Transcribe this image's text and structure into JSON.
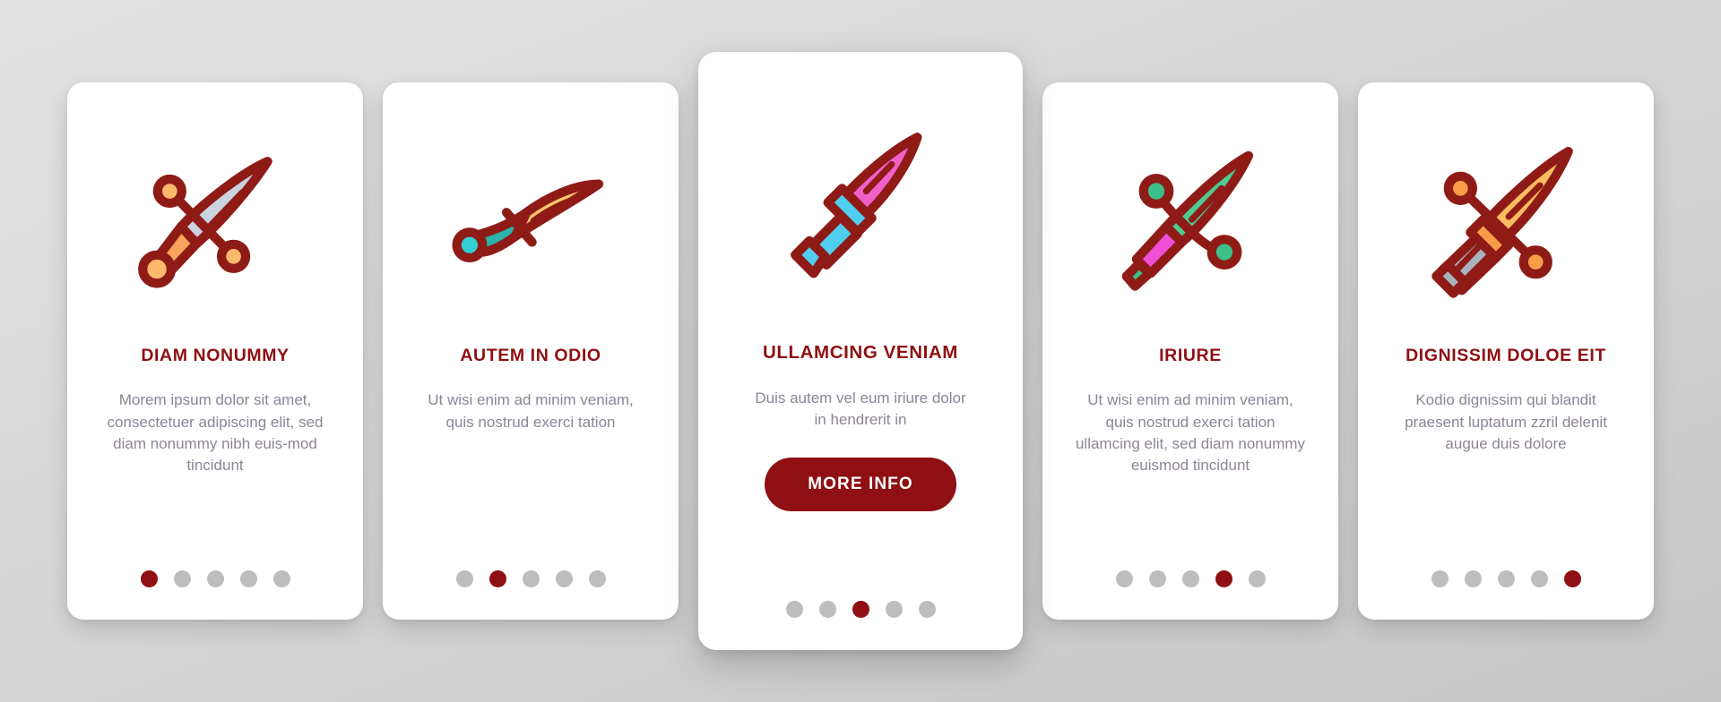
{
  "theme": {
    "accent": "#8f0f12",
    "body_text": "#8d8494",
    "dot_inactive": "#bdbdbd",
    "card_bg": "#ffffff",
    "page_bg": "#d6d6d6",
    "icon_outline": "#8f1b16"
  },
  "cards": [
    {
      "icon": "dagger-steel-icon",
      "icon_colors": {
        "blade": "#ccd3e0",
        "handle": "#f9a35c",
        "knobs": "#fdb96b",
        "outline": "#8f1b16"
      },
      "title": "DIAM NONUMMY",
      "body": "Morem ipsum dolor sit amet, consectetuer adipiscing elit, sed diam nonummy nibh euis-mod tincidunt",
      "has_button": false,
      "button_label": "",
      "dots": {
        "count": 5,
        "active": 1
      },
      "featured": false
    },
    {
      "icon": "scimitar-curved-icon",
      "icon_colors": {
        "blade": "#fbc56b",
        "handle": "#2bb3ac",
        "knobs": "#33cfd4",
        "outline": "#8f1b16"
      },
      "title": "AUTEM IN ODIO",
      "body": "Ut wisi enim ad minim veniam, quis nostrud exerci tation",
      "has_button": false,
      "button_label": "",
      "dots": {
        "count": 5,
        "active": 2
      },
      "featured": false
    },
    {
      "icon": "dagger-pink-icon",
      "icon_colors": {
        "blade": "#f061c8",
        "handle": "#50cef0",
        "knobs": "#50cef0",
        "outline": "#8f1b16"
      },
      "title": "ULLAMCING VENIAM",
      "body": "Duis autem vel eum iriure dolor in hendrerit in",
      "has_button": true,
      "button_label": "MORE INFO",
      "dots": {
        "count": 5,
        "active": 3
      },
      "featured": true
    },
    {
      "icon": "dagger-green-icon",
      "icon_colors": {
        "blade": "#4fc98f",
        "handle": "#ef4fd4",
        "knobs": "#3cc08a",
        "outline": "#8f1b16"
      },
      "title": "IRIURE",
      "body": "Ut wisi enim ad minim veniam, quis nostrud exerci tation ullamcing elit, sed diam nonummy euismod tincidunt",
      "has_button": false,
      "button_label": "",
      "dots": {
        "count": 5,
        "active": 4
      },
      "featured": false
    },
    {
      "icon": "sword-gold-icon",
      "icon_colors": {
        "blade": "#fcbc60",
        "handle": "#a8b2bd",
        "knobs": "#f79c48",
        "outline": "#8f1b16"
      },
      "title": "DIGNISSIM DOLOE EIT",
      "body": "Kodio dignissim qui blandit praesent luptatum zzril delenit augue duis dolore",
      "has_button": false,
      "button_label": "",
      "dots": {
        "count": 5,
        "active": 5
      },
      "featured": false
    }
  ]
}
